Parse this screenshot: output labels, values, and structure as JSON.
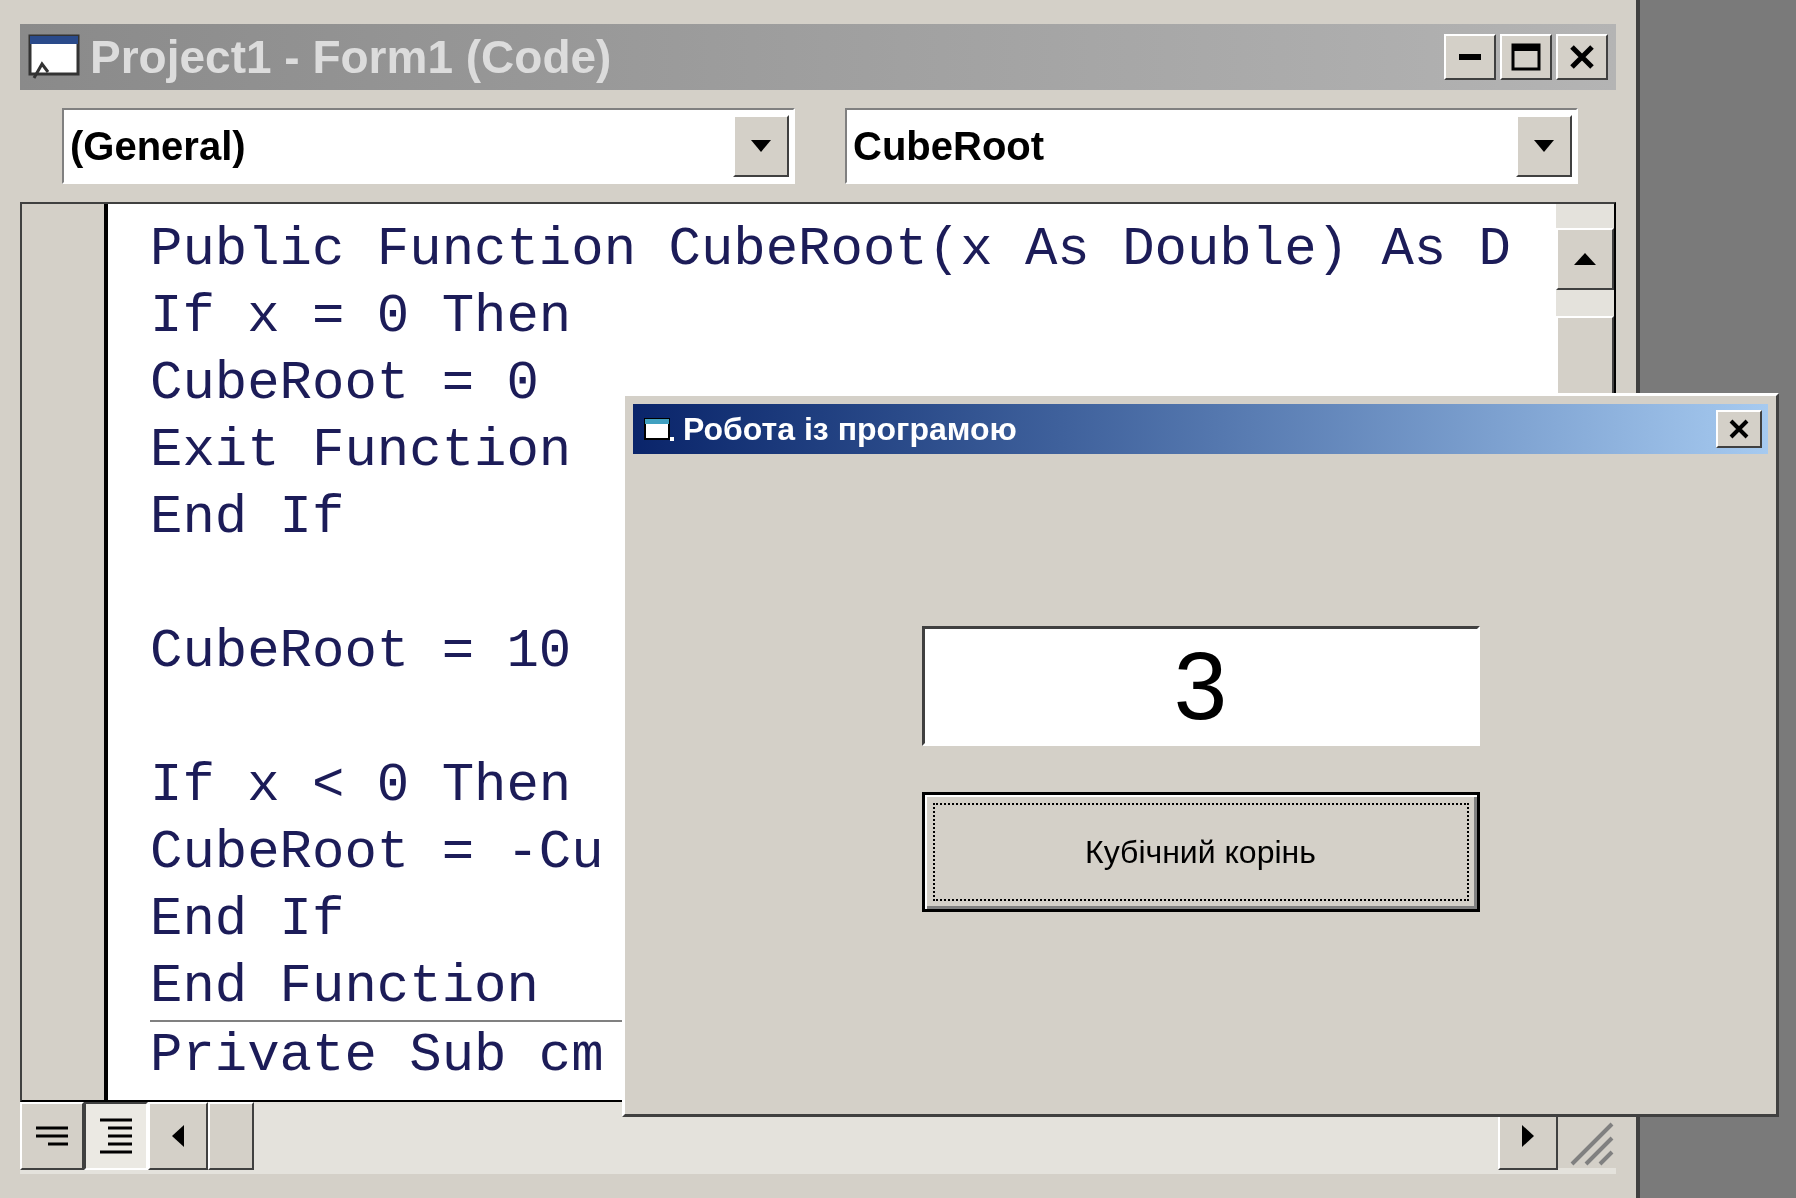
{
  "ide": {
    "title": "Project1 - Form1 (Code)",
    "object_combo": "(General)",
    "procedure_combo": "CubeRoot",
    "procedures": [
      {
        "paragraphs": [
          [
            "Public Function CubeRoot(x As Double) As D",
            "If x = 0 Then",
            "CubeRoot = 0",
            "Exit Function",
            "End If"
          ],
          [
            "CubeRoot = 10"
          ],
          [
            "If x < 0 Then",
            "CubeRoot = -Cu",
            "End If",
            "End Function"
          ]
        ]
      },
      {
        "paragraphs": [
          [
            "Private Sub cm"
          ]
        ]
      }
    ]
  },
  "dialog": {
    "title": "Робота із програмою",
    "result_field": {
      "value": "3"
    },
    "buttons": [
      {
        "label": "Кубічний корінь",
        "focused": true
      }
    ]
  }
}
